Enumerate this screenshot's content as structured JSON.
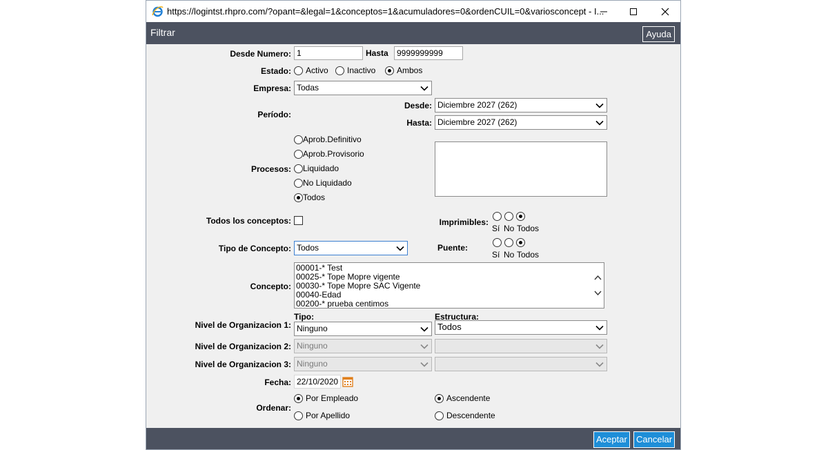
{
  "window": {
    "url": "https://logintst.rhpro.com/?opant=&legal=1&conceptos=1&acumuladores=0&ordenCUIL=0&variosconcept - I..."
  },
  "header": {
    "title": "Filtrar",
    "help_label": "Ayuda"
  },
  "form": {
    "desde_numero": {
      "label": "Desde Numero:",
      "value": "1"
    },
    "hasta": {
      "label": "Hasta",
      "value": "9999999999"
    },
    "estado": {
      "label": "Estado:",
      "options": [
        "Activo",
        "Inactivo",
        "Ambos"
      ],
      "selected": "Ambos"
    },
    "empresa": {
      "label": "Empresa:",
      "value": "Todas"
    },
    "periodo": {
      "label": "Período:",
      "desde_label": "Desde:",
      "desde_value": "Diciembre 2027 (262)",
      "hasta_label": "Hasta:",
      "hasta_value": "Diciembre 2027 (262)"
    },
    "procesos": {
      "label": "Procesos:",
      "options": [
        "Aprob.Definitivo",
        "Aprob.Provisorio",
        "Liquidado",
        "No Liquidado",
        "Todos"
      ],
      "selected": "Todos"
    },
    "todos_conceptos": {
      "label": "Todos los conceptos:",
      "checked": false
    },
    "imprimibles": {
      "label": "Imprimibles:",
      "options": [
        "Sí",
        "No",
        "Todos"
      ],
      "selected": "Todos"
    },
    "tipo_concepto": {
      "label": "Tipo de Concepto:",
      "value": "Todos"
    },
    "puente": {
      "label": "Puente:",
      "options": [
        "Sí",
        "No",
        "Todos"
      ],
      "selected": "Todos"
    },
    "concepto": {
      "label": "Concepto:",
      "items": [
        "00001-* Test",
        "00025-* Tope Mopre vigente",
        "00030-* Tope Mopre SAC Vigente",
        "00040-Edad",
        "00200-* prueba centimos"
      ]
    },
    "nivel_headers": {
      "tipo": "Tipo:",
      "estructura": "Estructura:"
    },
    "nivel1": {
      "label": "Nivel de Organizacion 1:",
      "tipo": "Ninguno",
      "estructura": "Todos"
    },
    "nivel2": {
      "label": "Nivel de Organizacion 2:",
      "tipo": "Ninguno",
      "estructura": ""
    },
    "nivel3": {
      "label": "Nivel de Organizacion 3:",
      "tipo": "Ninguno",
      "estructura": ""
    },
    "fecha": {
      "label": "Fecha:",
      "value": "22/10/2020"
    },
    "ordenar": {
      "label": "Ordenar:",
      "opt1": "Por Empleado",
      "opt2": "Por Apellido",
      "selected1": "Por Empleado",
      "dir1": "Ascendente",
      "dir2": "Descendente",
      "selected2": "Ascendente"
    }
  },
  "footer": {
    "accept_label": "Aceptar",
    "cancel_label": "Cancelar"
  },
  "colors": {
    "header_bg": "#4c5260",
    "button_bg": "#1e8ed8",
    "form_bg": "#f0f0f0"
  }
}
